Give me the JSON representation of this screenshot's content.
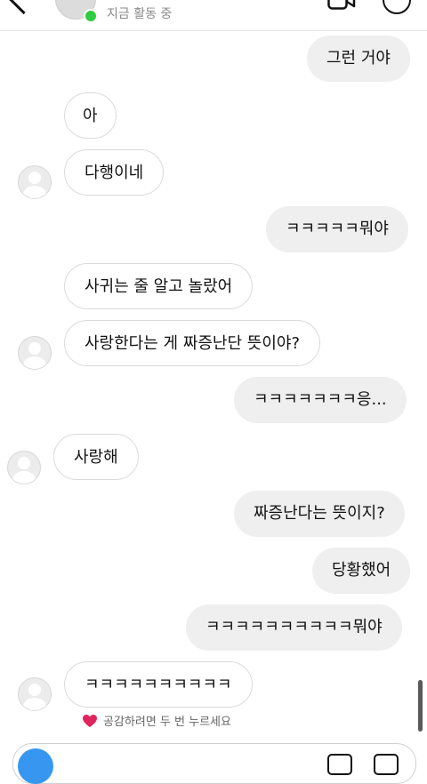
{
  "header": {
    "status": "지금 활동 중",
    "colors": {
      "online": "#2ecc40"
    },
    "icons": [
      "back-chevron-icon",
      "video-call-icon",
      "info-icon"
    ]
  },
  "messages": [
    {
      "side": "out",
      "text": "그런 거야"
    },
    {
      "side": "in",
      "text": "아"
    },
    {
      "side": "in",
      "text": "다행이네"
    },
    {
      "side": "out",
      "text": "ㅋㅋㅋㅋㅋ뭐야"
    },
    {
      "side": "in",
      "text": "사귀는 줄 알고 놀랐어"
    },
    {
      "side": "in",
      "text": "사랑한다는 게 짜증난단 뜻이야?"
    },
    {
      "side": "out",
      "text": "ㅋㅋㅋㅋㅋㅋㅋ응..."
    },
    {
      "side": "in",
      "text": "사랑해"
    },
    {
      "side": "out",
      "text": "짜증난다는 뜻이지?"
    },
    {
      "side": "out",
      "text": "당황했어"
    },
    {
      "side": "out",
      "text": "ㅋㅋㅋㅋㅋㅋㅋㅋㅋㅋ뭐야"
    },
    {
      "side": "in",
      "text": "ㅋㅋㅋㅋㅋㅋㅋㅋㅋㅋ"
    }
  ],
  "reaction_hint": "공감하려면 두 번 누르세요",
  "colors": {
    "incoming_bubble_border": "#dbdbdb",
    "outgoing_bubble_bg": "#efefef",
    "camera_button": "#3797f0",
    "heart": "#e0245e"
  }
}
